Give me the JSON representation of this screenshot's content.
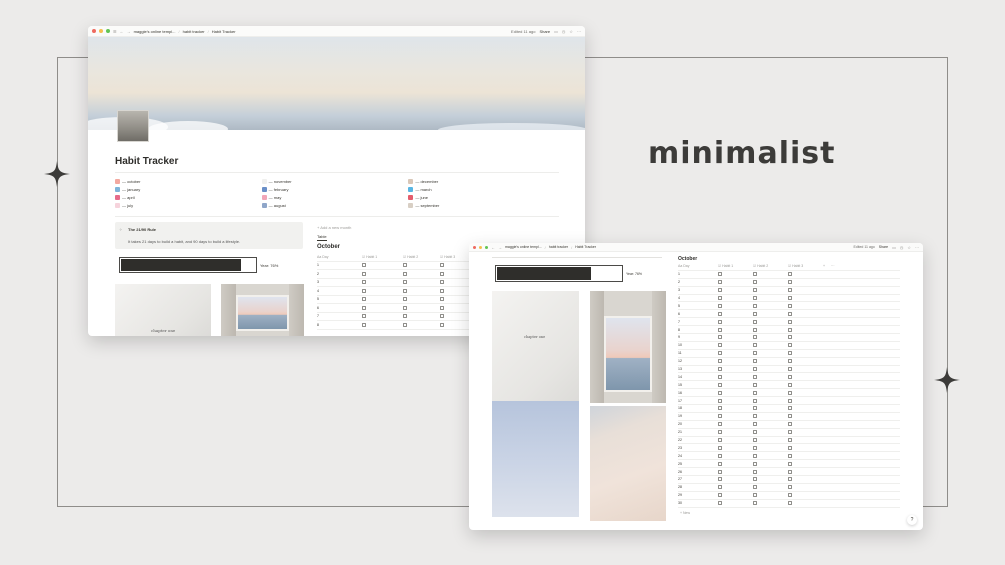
{
  "brand_word": "minimalist",
  "window1": {
    "breadcrumbs": [
      "maggie's online templ...",
      "habit tracker",
      "Habit Tracker"
    ],
    "edited": "Edited 11 ago",
    "share": "Share",
    "page_title": "Habit Tracker",
    "months": [
      {
        "label": "— october",
        "color": "#f3a9a0"
      },
      {
        "label": "— november",
        "color": "#f0f0ee"
      },
      {
        "label": "— december",
        "color": "#d9c7b8"
      },
      {
        "label": "— january",
        "color": "#7fb4d9"
      },
      {
        "label": "— february",
        "color": "#6a8fc7"
      },
      {
        "label": "— march",
        "color": "#59b6e3"
      },
      {
        "label": "— april",
        "color": "#e66b8a"
      },
      {
        "label": "— may",
        "color": "#f1a6b8"
      },
      {
        "label": "— june",
        "color": "#e45d6c"
      },
      {
        "label": "— july",
        "color": "#f6d3dc"
      },
      {
        "label": "— august",
        "color": "#8fa6c9"
      },
      {
        "label": "— september",
        "color": "#d8cfc4"
      }
    ],
    "callout": {
      "title": "The 21/90 Rule",
      "text": "It takes 21 days to build a habit, and 90 days to build a lifestyle."
    },
    "progress": {
      "label": "Year: 76%",
      "fraction": 0.9
    },
    "photo_caption": "chapter one",
    "new_month": "+ Add a new month",
    "table_tab": "Table",
    "db_title": "October",
    "columns": [
      "Aa Day",
      "☑ Habit 1",
      "☑ Habit 2",
      "☑ Habit 3"
    ],
    "rows": [
      "1",
      "2",
      "3",
      "4",
      "5",
      "6",
      "7",
      "8"
    ]
  },
  "window2": {
    "breadcrumbs": [
      "maggie's online templ...",
      "habit tracker",
      "Habit Tracker"
    ],
    "edited": "Edited 11 ago",
    "share": "Share",
    "progress": {
      "label": "Year: 76%",
      "fraction": 0.76
    },
    "photo_caption": "chapter one",
    "db_title": "October",
    "columns": [
      "Aa Day",
      "☑ Habit 1",
      "☑ Habit 2",
      "☑ Habit 3",
      "+",
      "···"
    ],
    "rows": [
      "1",
      "2",
      "3",
      "4",
      "5",
      "6",
      "7",
      "8",
      "9",
      "10",
      "11",
      "12",
      "13",
      "14",
      "15",
      "16",
      "17",
      "18",
      "19",
      "20",
      "21",
      "22",
      "23",
      "24",
      "25",
      "26",
      "27",
      "28",
      "29",
      "30"
    ],
    "add_new": "+ New",
    "help": "?"
  }
}
